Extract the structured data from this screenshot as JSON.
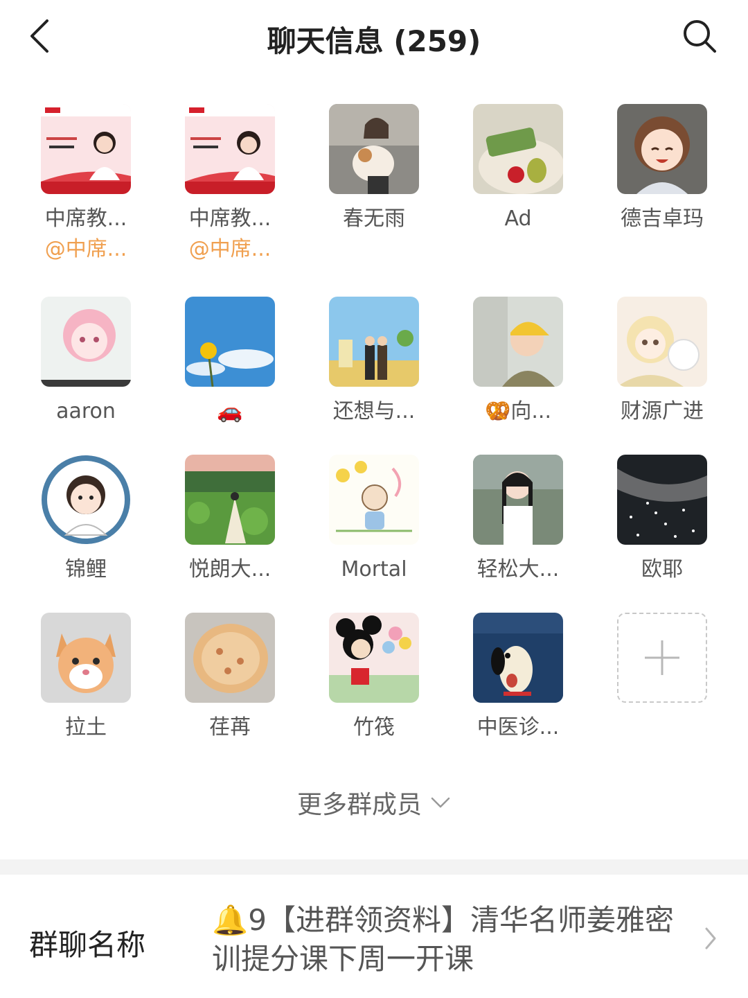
{
  "header": {
    "title": "聊天信息 (259)"
  },
  "members": [
    {
      "name": "中席教...",
      "nick": "@中席...",
      "avatar": "teacher-poster-1-avatar"
    },
    {
      "name": "中席教...",
      "nick": "@中席...",
      "avatar": "teacher-poster-2-avatar"
    },
    {
      "name": "春无雨",
      "nick": "",
      "avatar": "girl-with-dog-avatar"
    },
    {
      "name": "Ad",
      "nick": "",
      "avatar": "fruit-basket-avatar"
    },
    {
      "name": "德吉卓玛",
      "nick": "",
      "avatar": "anime-girl-avatar"
    },
    {
      "name": "aaron",
      "nick": "",
      "avatar": "pink-anime-avatar"
    },
    {
      "name": "🚗",
      "nick": "",
      "avatar": "blue-sky-avatar"
    },
    {
      "name": "还想与...",
      "nick": "",
      "avatar": "couple-illustration-avatar"
    },
    {
      "name": "🥨向...",
      "nick": "",
      "avatar": "child-yellow-hat-avatar"
    },
    {
      "name": "财源广进",
      "nick": "",
      "avatar": "anime-cat-girl-avatar"
    },
    {
      "name": "锦鲤",
      "nick": "",
      "avatar": "doctor-cartoon-avatar"
    },
    {
      "name": "悦朗大...",
      "nick": "",
      "avatar": "lotus-pond-avatar"
    },
    {
      "name": "Mortal",
      "nick": "",
      "avatar": "flower-kid-drawing-avatar"
    },
    {
      "name": "轻松大...",
      "nick": "",
      "avatar": "braided-girl-avatar"
    },
    {
      "name": "欧耶",
      "nick": "",
      "avatar": "starry-night-avatar"
    },
    {
      "name": "拉土",
      "nick": "",
      "avatar": "orange-kitten-avatar"
    },
    {
      "name": "荏苒",
      "nick": "",
      "avatar": "pizza-avatar"
    },
    {
      "name": "竹筏",
      "nick": "",
      "avatar": "mickey-flowers-avatar"
    },
    {
      "name": "中医诊...",
      "nick": "",
      "avatar": "cartoon-dog-sea-avatar"
    }
  ],
  "add_member": {
    "icon": "plus-icon"
  },
  "more_members": {
    "label": "更多群成员"
  },
  "group_name": {
    "label": "群聊名称",
    "value": "🔔9【进群领资料】清华名师姜雅密训提分课下周一开课"
  },
  "colors": {
    "mention": "#f0a050",
    "divider": "#f3f3f3"
  }
}
